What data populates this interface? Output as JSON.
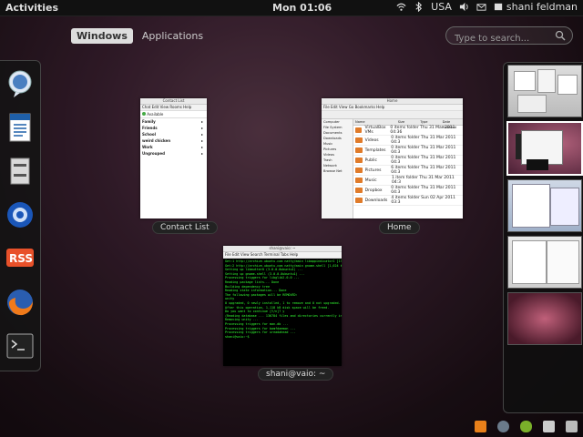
{
  "topbar": {
    "activities": "Activities",
    "clock": "Mon 01:06",
    "keyboard": "USA",
    "user": "shani feldman",
    "icons": [
      "wifi-icon",
      "bluetooth-icon",
      "volume-icon",
      "mail-icon",
      "power-icon"
    ]
  },
  "tabs": {
    "windows": "Windows",
    "applications": "Applications"
  },
  "search": {
    "placeholder": "Type to search..."
  },
  "dash": {
    "items": [
      "empathy-icon",
      "writer-icon",
      "files-icon",
      "thunderbird-icon",
      "rss-icon",
      "firefox-icon",
      "terminal-icon"
    ]
  },
  "windows": [
    {
      "caption": "Contact List",
      "title": "Contact List",
      "menu": "Chat  Edit  View  Rooms  Help",
      "status": "Available",
      "groups": [
        "Family",
        "Friends",
        "School",
        "weird chicken",
        "Work",
        "Ungrouped"
      ]
    },
    {
      "caption": "Home",
      "title": "Home",
      "menu": "File  Edit  View  Go  Bookmarks  Help",
      "sidebar": [
        "Computer",
        "File System",
        "Documents",
        "Downloads",
        "Music",
        "Pictures",
        "Videos",
        "Trash",
        "Network",
        "Browse Net"
      ],
      "columns": [
        "Name",
        "Size",
        "Type",
        "Date Modified"
      ],
      "rows": [
        {
          "name": "VirtualBox VMs",
          "info": "0 items folder Thu 31 Mar 2011 04:36"
        },
        {
          "name": "Videos",
          "info": "0 items folder Thu 31 Mar 2011 04:3"
        },
        {
          "name": "Templates",
          "info": "0 items folder Thu 31 Mar 2011 04:3"
        },
        {
          "name": "Public",
          "info": "0 items folder Thu 31 Mar 2011 04:3"
        },
        {
          "name": "Pictures",
          "info": "6 items folder Thu 31 Mar 2011 04:3"
        },
        {
          "name": "Music",
          "info": "1 item folder Thu 31 Mar 2011 04:3"
        },
        {
          "name": "Dropbox",
          "info": "0 items folder Thu 31 Mar 2011 04:3"
        },
        {
          "name": "Downloads",
          "info": "4 items folder Sun 02 Apr 2011 03:3"
        }
      ]
    },
    {
      "caption": "shani@vaio: ~",
      "title": "shani@vaio: ~",
      "menu": "File  Edit  View  Search  Terminal  Tabs  Help",
      "lines": [
        "Get:1 http://archive.ubuntu.com natty/main libappindicator1 [13.4 kB]",
        "Get:2 http://archive.ubuntu.com natty/main gnome-shell [1,024 kB]",
        "Setting up libmutter0 (3.0.0-0ubuntu1) ...",
        "Setting up gnome-shell (3.0.0-0ubuntu1) ...",
        "Processing triggers for libglib2.0-0 ...",
        "Reading package lists... Done",
        "Building dependency tree",
        "Reading state information... Done",
        "The following packages will be REMOVED:",
        "  unity",
        "0 upgraded, 0 newly installed, 1 to remove and 0 not upgraded.",
        "After this operation, 1,118 kB disk space will be freed.",
        "Do you want to continue [Y/n]? y",
        "(Reading database ... 136784 files and directories currently installed.)",
        "Removing unity ...",
        "Processing triggers for man-db ...",
        "Processing triggers for bamfdaemon ...",
        "Processing triggers for ureadahead ...",
        "shani@vaio:~$"
      ]
    }
  ],
  "tray": [
    "vlc-icon",
    "rhythmbox-icon",
    "chat-icon",
    "dropbox-icon",
    "keyboard-icon"
  ]
}
